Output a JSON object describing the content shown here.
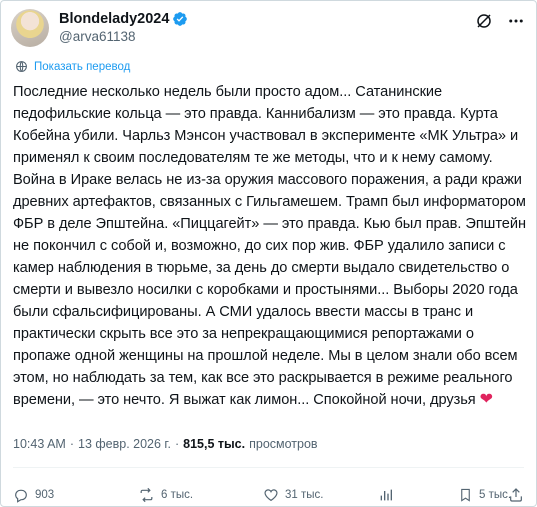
{
  "author": {
    "display_name": "Blondelady2024",
    "handle": "@arva61138",
    "verified": true,
    "verified_color": "#1d9bf0"
  },
  "translate": {
    "label": "Показать перевод"
  },
  "post": {
    "text": "Последние несколько недель были просто адом... Сатанинские педофильские кольца — это правда. Каннибализм — это правда. Курта Кобейна убили. Чарльз Мэнсон участвовал в эксперименте «МК Ультра» и применял к своим последователям те же методы, что и к нему самому. Война в Ираке велась не из-за оружия массового поражения, а ради кражи древних артефактов, связанных с Гильгамешем. Трамп был информатором ФБР в деле Эпштейна. «Пиццагейт» — это правда. Кью был прав. Эпштейн не покончил с собой и, возможно, до сих пор жив. ФБР удалило записи с камер наблюдения в тюрьме, за день до смерти выдало свидетельство о смерти и вывезло носилки с коробками и простынями... Выборы 2020 года были сфальсифицированы. А СМИ удалось ввести массы в транс и практически скрыть все это за непрекращающимися репортажами о пропаже одной женщины на прошлой неделе. Мы в целом знали обо всем этом, но наблюдать за тем, как все это раскрывается в режиме реального времени, — это нечто. Я выжат как лимон... Спокойной ночи, друзья",
    "heart_emoji": "❤"
  },
  "meta": {
    "time": "10:43 AM",
    "separator": "·",
    "date": "13 февр. 2026 г.",
    "separator2": "·",
    "views_count": "815,5 тыс.",
    "views_label": "просмотров"
  },
  "actions": {
    "replies": "903",
    "reposts": "6 тыс.",
    "likes": "31 тыс.",
    "bookmarks": "5 тыс."
  },
  "icons": {
    "header_left": "grok-slash-icon",
    "header_right": "more-icon",
    "translate": "translate-globe-icon",
    "reply": "reply-icon",
    "repost": "repost-icon",
    "like": "heart-icon",
    "views": "views-chart-icon",
    "bookmark": "bookmark-icon",
    "share": "share-icon"
  },
  "colors": {
    "accent": "#1d9bf0",
    "muted": "#536471",
    "heart": "#e0245e"
  }
}
